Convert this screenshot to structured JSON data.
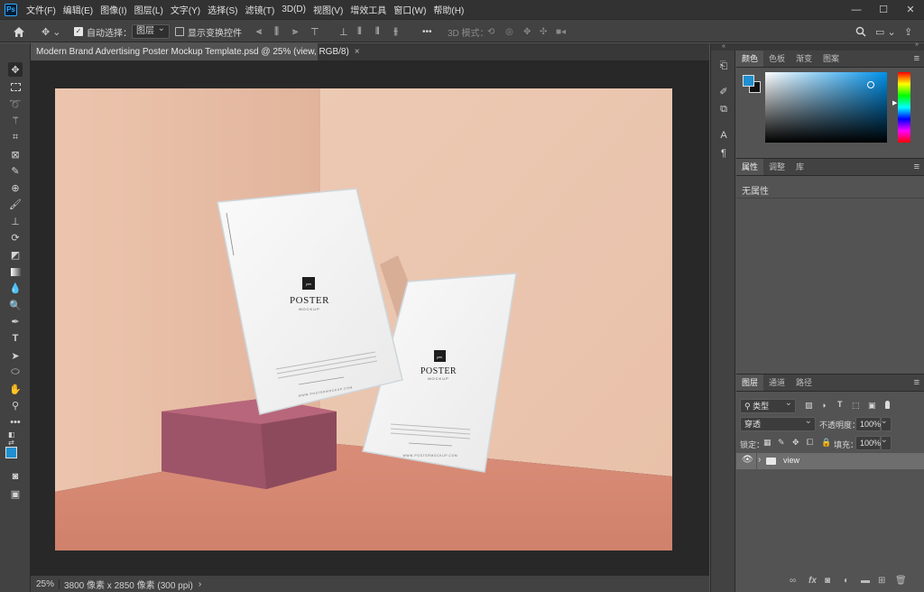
{
  "app": {
    "logo": "Ps"
  },
  "menu": [
    "文件(F)",
    "编辑(E)",
    "图像(I)",
    "图层(L)",
    "文字(Y)",
    "选择(S)",
    "滤镜(T)",
    "3D(D)",
    "视图(V)",
    "增效工具",
    "窗口(W)",
    "帮助(H)"
  ],
  "window_controls": {
    "minimize": "—",
    "maximize": "☐",
    "close": "✕"
  },
  "options": {
    "auto_select_label": "自动选择：",
    "auto_select_checked": true,
    "auto_select_value": "图层",
    "show_transform_label": "显示变换控件",
    "more": "•••",
    "mode_3d_label": "3D 模式："
  },
  "document": {
    "tab_title": "Modern Brand Advertising Poster Mockup Template.psd @ 25% (view, RGB/8)",
    "close": "×",
    "zoom": "25%",
    "info": "3800 像素 x 2850 像素 (300 ppi)",
    "info_arrow": "›"
  },
  "poster": {
    "logo_mark": "pm",
    "title": "POSTER",
    "subtitle": "MOCKUP",
    "url": "WWW.POSTERMOCKUP.COM"
  },
  "color_panel": {
    "tabs": [
      "颜色",
      "色板",
      "渐变",
      "图案"
    ],
    "foreground": "#1f8fd0",
    "background": "#111111"
  },
  "properties_panel": {
    "tabs": [
      "属性",
      "调整",
      "库"
    ],
    "empty_text": "无属性"
  },
  "layers_panel": {
    "tabs": [
      "图层",
      "通道",
      "路径"
    ],
    "filter_label": "类型",
    "blend_mode": "穿透",
    "opacity_label": "不透明度：",
    "opacity_value": "100%",
    "lock_label": "锁定：",
    "fill_label": "填充：",
    "fill_value": "100%",
    "layers": [
      {
        "name": "view",
        "visible": true,
        "type": "group"
      }
    ]
  }
}
